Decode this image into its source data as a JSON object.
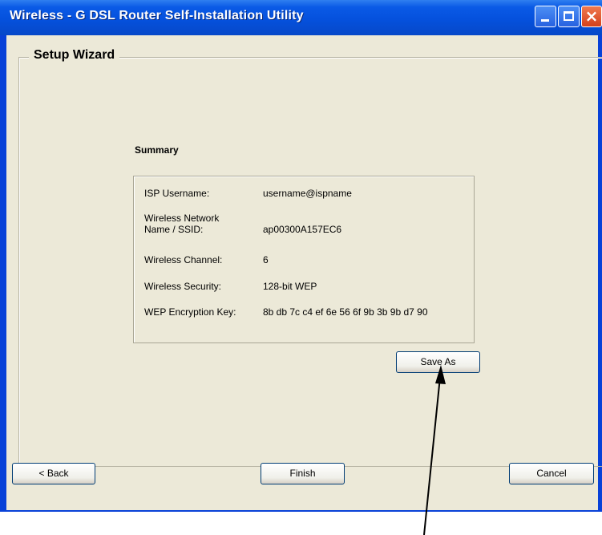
{
  "window": {
    "title": "Wireless - G DSL Router Self-Installation Utility",
    "close_glyph": "×"
  },
  "wizard": {
    "group_label": "Setup Wizard",
    "summary_title": "Summary",
    "rows": [
      {
        "label": "ISP Username:",
        "value": "username@ispname"
      },
      {
        "label_line1": "Wireless Network",
        "label_line2": "Name / SSID:",
        "value": "ap00300A157EC6"
      },
      {
        "label": "Wireless Channel:",
        "value": "6"
      },
      {
        "label": "Wireless Security:",
        "value": "128-bit WEP"
      },
      {
        "label": "WEP Encryption Key:",
        "value": "8b db 7c c4 ef 6e 56 6f 9b 3b 9b d7 90"
      }
    ],
    "save_as_label": "Save As"
  },
  "footer": {
    "back_label": "< Back",
    "finish_label": "Finish",
    "cancel_label": "Cancel"
  },
  "icons": {
    "minimize": "minimize-icon",
    "maximize": "maximize-icon",
    "close": "close-icon",
    "annotation": "annotation-arrow"
  },
  "colors": {
    "titlebar": "#0551dd",
    "client_bg": "#ece9d8",
    "close_button": "#d4401c"
  }
}
